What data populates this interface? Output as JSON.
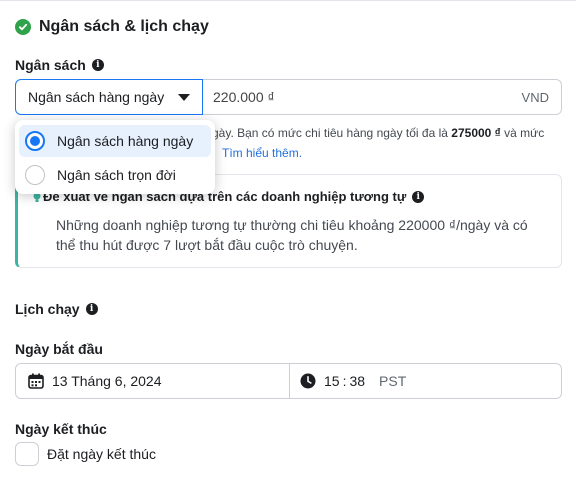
{
  "section": {
    "title": "Ngân sách & lịch chạy"
  },
  "budget": {
    "label": "Ngân sách",
    "type_selected": "Ngân sách hàng ngày",
    "amount": "220.000 ₫",
    "currency": "VND",
    "helper_visible_1": "gày. Bạn có mức chi tiêu hàng ngày tối đa là ",
    "helper_bold": "275000 ₫",
    "helper_visible_2": " và mức",
    "helper_link": "Tìm hiểu thêm.",
    "options": [
      {
        "label": "Ngân sách hàng ngày",
        "selected": true
      },
      {
        "label": "Ngân sách trọn đời",
        "selected": false
      }
    ]
  },
  "recommendation": {
    "title": "Đề xuất về ngân sách dựa trên các doanh nghiệp tương tự",
    "body": "Những doanh nghiệp tương tự thường chi tiêu khoảng 220000 ₫/ngày và có thể thu hút được 7 lượt bắt đầu cuộc trò chuyện.",
    "accent_color": "#3cb4a2"
  },
  "schedule": {
    "label": "Lịch chạy",
    "start_label": "Ngày bắt đầu",
    "start_date": "13 Tháng 6, 2024",
    "start_hour": "15",
    "start_minute": "38",
    "timezone": "PST",
    "end_label": "Ngày kết thúc",
    "end_checkbox_label": "Đặt ngày kết thúc",
    "end_checked": false
  },
  "colors": {
    "primary": "#1877f2",
    "success": "#31a24c",
    "link": "#216fdb"
  },
  "icons": {
    "title": "check-circle-icon",
    "info": "info-icon",
    "dropdown": "caret-down-icon",
    "calendar": "calendar-icon",
    "clock": "clock-icon",
    "recommendation": "lightbulb-icon"
  }
}
